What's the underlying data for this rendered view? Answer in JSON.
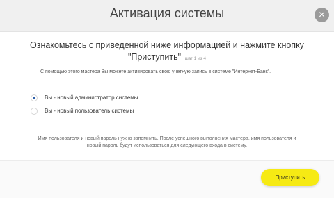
{
  "dialog": {
    "title": "Активация системы",
    "close_icon": "×"
  },
  "intro": {
    "line1": "Ознакомьтесь с приведенной ниже информацией и нажмите кнопку",
    "line2": "\"Приступить\"",
    "step": "шаг 1 из 4"
  },
  "description": "С помощью этого мастера Вы можете активировать свою учетную запись в системе \"Интернет-Банк\".",
  "options": [
    {
      "label": "Вы - новый администратор системы",
      "selected": true
    },
    {
      "label": "Вы - новый пользователь системы",
      "selected": false
    }
  ],
  "note": {
    "line1": "Имя пользователя и новый пароль нужно запомнить. После успешного выполнения мастера, имя пользователя и",
    "line2": "новый пароль будут использоваться для следующего входа в систему."
  },
  "footer": {
    "start_label": "Приступить"
  },
  "colors": {
    "accent_button": "#f6ea14",
    "radio_selected": "#2c5ea8"
  }
}
